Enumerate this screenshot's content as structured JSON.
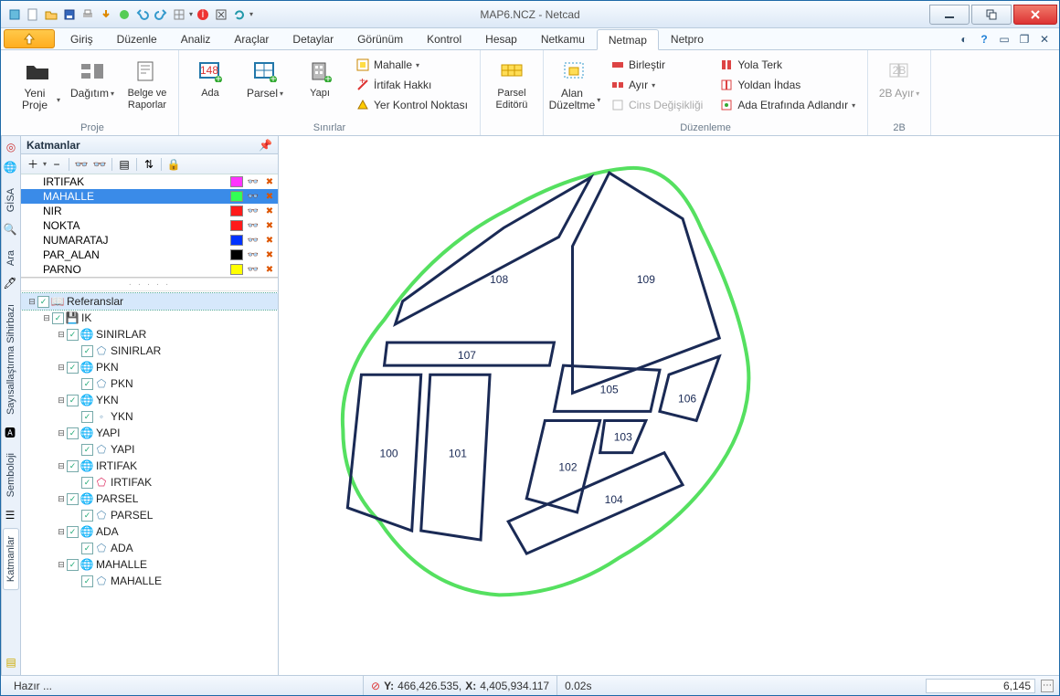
{
  "window": {
    "title": "MAP6.NCZ - Netcad"
  },
  "menubar": {
    "items": [
      "Giriş",
      "Düzenle",
      "Analiz",
      "Araçlar",
      "Detaylar",
      "Görünüm",
      "Kontrol",
      "Hesap",
      "Netkamu",
      "Netmap",
      "Netpro"
    ],
    "active": "Netmap"
  },
  "ribbon": {
    "groups": {
      "proje": {
        "label": "Proje",
        "yeni": "Yeni Proje",
        "dagitim": "Dağıtım",
        "belge": "Belge ve Raporlar"
      },
      "sinirlar": {
        "label": "Sınırlar",
        "ada": "Ada",
        "parsel": "Parsel",
        "yapi": "Yapı",
        "mahalle": "Mahalle",
        "irtifak": "İrtifak Hakkı",
        "ykn": "Yer Kontrol Noktası"
      },
      "parsel_ed": {
        "label": "",
        "btn": "Parsel Editörü"
      },
      "duzenleme": {
        "label": "Düzenleme",
        "alan": "Alan Düzeltme",
        "birlestir": "Birleştir",
        "ayir": "Ayır",
        "cins": "Cins Değişikliği",
        "yola": "Yola Terk",
        "yoldan": "Yoldan İhdas",
        "ada_ad": "Ada Etrafında Adlandır"
      },
      "ikib": {
        "label": "2B",
        "btn": "2B",
        "ayir": "2B Ayır"
      }
    }
  },
  "panel": {
    "title": "Katmanlar",
    "layers": [
      {
        "name": "IRTIFAK",
        "color": "#ff33ff"
      },
      {
        "name": "MAHALLE",
        "color": "#33ff55",
        "selected": true
      },
      {
        "name": "NIR",
        "color": "#ff1a1a"
      },
      {
        "name": "NOKTA",
        "color": "#ff1a1a"
      },
      {
        "name": "NUMARATAJ",
        "color": "#0033ff"
      },
      {
        "name": "PAR_ALAN",
        "color": "#000000"
      },
      {
        "name": "PARNO",
        "color": "#ffff00"
      }
    ],
    "tree": [
      {
        "d": 0,
        "exp": "-",
        "lbl": "Referanslar",
        "icon": "book",
        "sel": true
      },
      {
        "d": 1,
        "exp": "-",
        "lbl": "IK",
        "icon": "disk"
      },
      {
        "d": 2,
        "exp": "-",
        "lbl": "SINIRLAR",
        "icon": "globe"
      },
      {
        "d": 3,
        "exp": "",
        "lbl": "SINIRLAR",
        "icon": "poly"
      },
      {
        "d": 2,
        "exp": "-",
        "lbl": "PKN",
        "icon": "globe"
      },
      {
        "d": 3,
        "exp": "",
        "lbl": "PKN",
        "icon": "poly"
      },
      {
        "d": 2,
        "exp": "-",
        "lbl": "YKN",
        "icon": "globe"
      },
      {
        "d": 3,
        "exp": "",
        "lbl": "YKN",
        "icon": "dot"
      },
      {
        "d": 2,
        "exp": "-",
        "lbl": "YAPI",
        "icon": "globe"
      },
      {
        "d": 3,
        "exp": "",
        "lbl": "YAPI",
        "icon": "poly"
      },
      {
        "d": 2,
        "exp": "-",
        "lbl": "IRTIFAK",
        "icon": "globe"
      },
      {
        "d": 3,
        "exp": "",
        "lbl": "IRTIFAK",
        "icon": "polyp"
      },
      {
        "d": 2,
        "exp": "-",
        "lbl": "PARSEL",
        "icon": "globe"
      },
      {
        "d": 3,
        "exp": "",
        "lbl": "PARSEL",
        "icon": "poly"
      },
      {
        "d": 2,
        "exp": "-",
        "lbl": "ADA",
        "icon": "globe"
      },
      {
        "d": 3,
        "exp": "",
        "lbl": "ADA",
        "icon": "poly"
      },
      {
        "d": 2,
        "exp": "-",
        "lbl": "MAHALLE",
        "icon": "globe"
      },
      {
        "d": 3,
        "exp": "",
        "lbl": "MAHALLE",
        "icon": "poly"
      }
    ]
  },
  "sidetabs": [
    "GİSA",
    "Ara",
    "Sayısallaştırma Sihirbazı",
    "Semboloji",
    "Katmanlar"
  ],
  "sidetab_active": "Katmanlar",
  "map": {
    "labels": [
      "100",
      "101",
      "102",
      "103",
      "104",
      "105",
      "106",
      "107",
      "108",
      "109"
    ]
  },
  "status": {
    "ready": "Hazır ...",
    "coords_label_y": "Y:",
    "coords_y": "466,426.535,",
    "coords_label_x": "X:",
    "coords_x": "4,405,934.117",
    "time": "0.02s",
    "scale": "6,145"
  }
}
